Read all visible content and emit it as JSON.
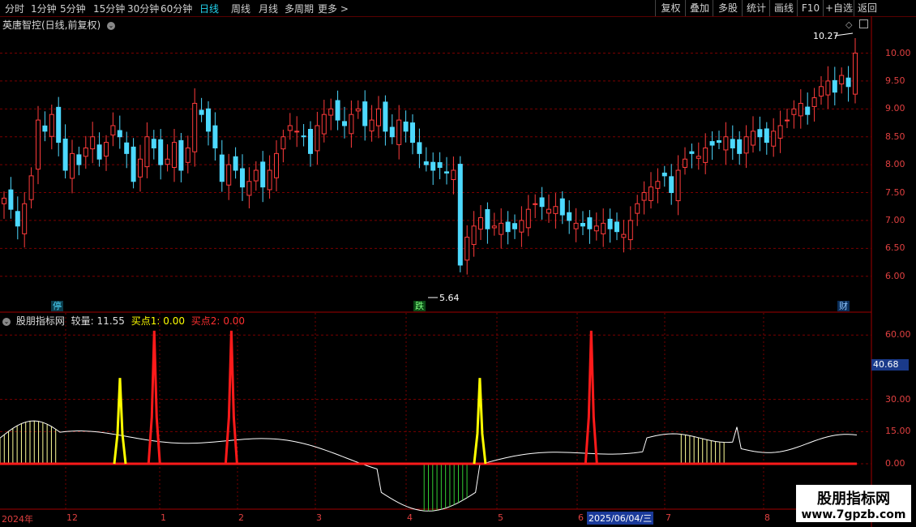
{
  "toolbar": {
    "periods": [
      "分时",
      "1分钟",
      "5分钟",
      "15分钟",
      "30分钟",
      "60分钟",
      "日线",
      "周线",
      "月线",
      "多周期",
      "更多 >"
    ],
    "active_period": "日线",
    "right_buttons": [
      "复权",
      "叠加",
      "多股",
      "统计",
      "画线",
      "F10",
      "+自选",
      "返回"
    ]
  },
  "main_chart": {
    "title": "英唐智控(日线,前复权)",
    "y_ticks": [
      "10.00",
      "9.50",
      "9.00",
      "8.50",
      "8.00",
      "7.50",
      "7.00",
      "6.50",
      "6.00"
    ],
    "high_label": "10.27",
    "low_label": "5.64",
    "tag_stop": "停",
    "tag_fall": "跌",
    "tag_finance": "财"
  },
  "indicator": {
    "name": "股朋指标网",
    "field1_label": "较量:",
    "field1_value": "11.55",
    "field2_label": "买点1:",
    "field2_value": "0.00",
    "field3_label": "买点2:",
    "field3_value": "0.00",
    "y_ticks": [
      "60.00",
      "30.00",
      "15.00",
      "0.00"
    ],
    "current_value": "40.68"
  },
  "x_axis": {
    "labels": [
      "2024年",
      "12",
      "1",
      "2",
      "3",
      "4",
      "5",
      "6",
      "7",
      "8"
    ],
    "cursor_date": "2025/06/04/三"
  },
  "watermark": {
    "line1": "股朋指标网",
    "line2": "www.7gpzb.com"
  },
  "colors": {
    "up": "#ff3b3b",
    "down": "#4dd9ff",
    "buy1": "#ffff00",
    "buy2": "#ff1a1a",
    "grid": "#7a0000"
  },
  "chart_data": {
    "type": "candlestick",
    "price_close": [
      7.4,
      7.2,
      6.9,
      7.3,
      7.8,
      8.8,
      8.6,
      8.9,
      8.4,
      7.9,
      8.2,
      8.0,
      8.3,
      8.5,
      8.1,
      8.4,
      8.7,
      8.5,
      8.2,
      7.7,
      8.1,
      8.5,
      8.3,
      8.0,
      8.1,
      8.4,
      7.9,
      8.3,
      9.1,
      8.9,
      8.6,
      8.3,
      7.7,
      8.0,
      7.9,
      7.6,
      7.7,
      7.9,
      7.6,
      7.9,
      8.2,
      8.5,
      8.7,
      8.6,
      8.5,
      8.2,
      8.7,
      8.9,
      9.0,
      8.8,
      8.7,
      8.9,
      9.0,
      8.7,
      8.8,
      9.0,
      8.6,
      8.5,
      8.8,
      8.6,
      8.4,
      8.2,
      8.0,
      7.9,
      7.95,
      7.85,
      7.9,
      6.2,
      6.7,
      6.9,
      7.05,
      6.85,
      6.9,
      6.95,
      6.8,
      6.85,
      7.0,
      7.2,
      7.3,
      7.25,
      7.2,
      7.25,
      7.1,
      7.0,
      6.95,
      6.9,
      6.85,
      6.9,
      6.95,
      6.85,
      6.8,
      6.75,
      7.0,
      7.3,
      7.5,
      7.6,
      7.7,
      7.8,
      7.5,
      7.9,
      8.1,
      8.2,
      8.15,
      8.3,
      8.35,
      8.4,
      8.5,
      8.3,
      8.2,
      8.5,
      8.6,
      8.5,
      8.4,
      8.6,
      8.7,
      8.8,
      9.0,
      9.1,
      8.9,
      9.2,
      9.4,
      9.5,
      9.3,
      9.6,
      9.4,
      10.0
    ],
    "indicator_series": [
      {
        "name": "较量",
        "note": "white line"
      },
      {
        "name": "买点1",
        "peaks_at": [
          0.14,
          0.56
        ],
        "peak_value": 40
      },
      {
        "name": "买点2",
        "peaks_at": [
          0.18,
          0.27,
          0.69
        ],
        "peak_value": 62
      }
    ],
    "ylim_price": [
      5.4,
      10.4
    ],
    "ylim_indicator": [
      -20,
      65
    ]
  }
}
